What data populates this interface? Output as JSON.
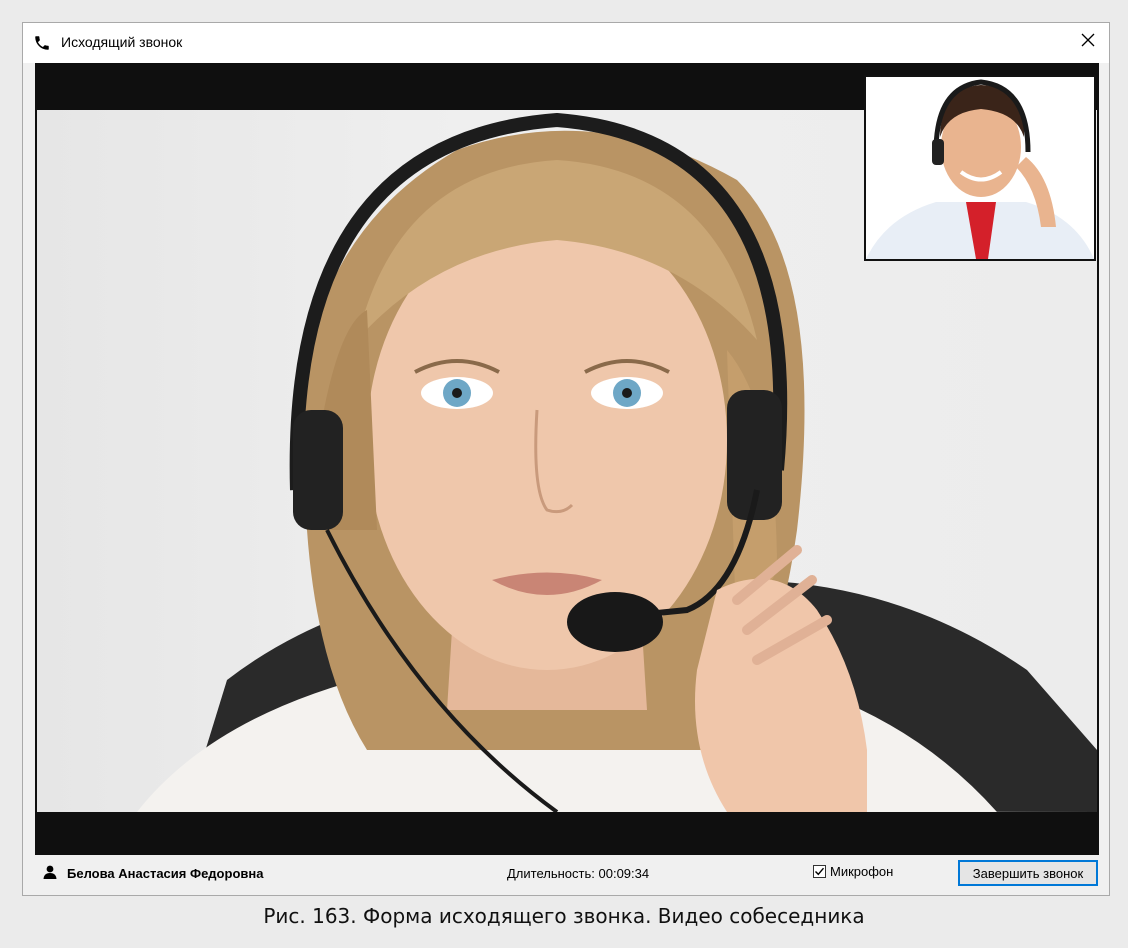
{
  "window": {
    "title": "Исходящий звонок",
    "title_icon": "phone-icon",
    "close_icon": "close-icon"
  },
  "status": {
    "caller_icon": "user-icon",
    "caller_name": "Белова Анастасия Федоровна",
    "duration_label": "Длительность:",
    "duration_value": "00:09:34",
    "microphone_label": "Микрофон",
    "microphone_checked": true,
    "end_call_label": "Завершить звонок"
  },
  "caption": "Рис. 163. Форма исходящего звонка. Видео собеседника",
  "colors": {
    "accent": "#0078d7",
    "video_background": "#0f0f0f"
  }
}
